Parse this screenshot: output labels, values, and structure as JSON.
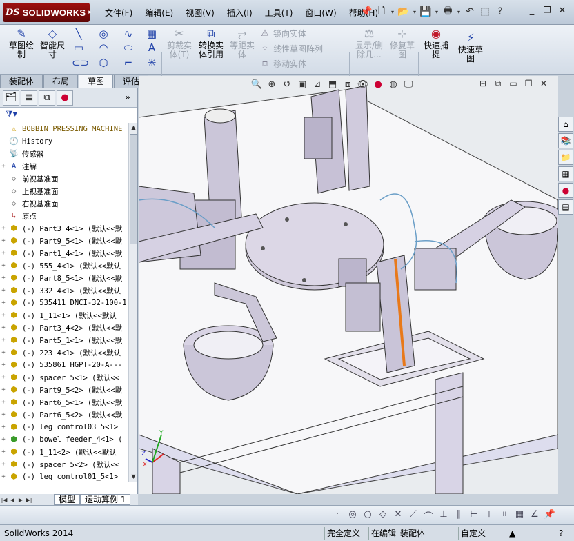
{
  "app": {
    "logo_ds": "DS",
    "logo_name": "SOLIDWORKS"
  },
  "menu": [
    "文件(F)",
    "编辑(E)",
    "视图(V)",
    "插入(I)",
    "工具(T)",
    "窗口(W)",
    "帮助(H)"
  ],
  "window_controls": [
    "_",
    "❐",
    "✕"
  ],
  "commands": {
    "sketch": "草图绘\n制",
    "smart_dim": "智能尺\n寸",
    "trim": "剪裁实\n体(T)",
    "convert": "转换实\n体引用",
    "offset": "等距实\n体",
    "mirror": "镜向实体",
    "linear_pattern": "线性草图阵列",
    "move": "移动实体",
    "show_delete": "显示/删\n除几...",
    "repair": "修复草\n图",
    "quick_snap": "快速捕\n捉",
    "rapid_sketch": "快速草\n图"
  },
  "tabs": [
    "装配体",
    "布局",
    "草图",
    "评估"
  ],
  "active_tab": "草图",
  "tree": {
    "root": "BOBBIN PRESSING MACHINE",
    "items": [
      {
        "label": "History",
        "icon": "history-icon",
        "exp": ""
      },
      {
        "label": "传感器",
        "icon": "sensor-icon",
        "exp": ""
      },
      {
        "label": "注解",
        "icon": "annotation-icon",
        "exp": "+"
      },
      {
        "label": "前视基准面",
        "icon": "plane-icon",
        "exp": ""
      },
      {
        "label": "上视基准面",
        "icon": "plane-icon",
        "exp": ""
      },
      {
        "label": "右视基准面",
        "icon": "plane-icon",
        "exp": ""
      },
      {
        "label": "原点",
        "icon": "origin-icon",
        "exp": ""
      },
      {
        "label": "(-) Part3_4<1> (默认<<默",
        "icon": "part-icon",
        "exp": "+"
      },
      {
        "label": "(-) Part9_5<1> (默认<<默",
        "icon": "part-icon",
        "exp": "+"
      },
      {
        "label": "(-) Part1_4<1> (默认<<默",
        "icon": "part-icon",
        "exp": "+"
      },
      {
        "label": "(-) 555_4<1> (默认<<默认",
        "icon": "part-icon",
        "exp": "+"
      },
      {
        "label": "(-) Part8_5<1> (默认<<默",
        "icon": "part-icon",
        "exp": "+"
      },
      {
        "label": "(-) 332_4<1> (默认<<默认",
        "icon": "part-icon",
        "exp": "+"
      },
      {
        "label": "(-) 535411 DNCI-32-100-1",
        "icon": "part-icon",
        "exp": "+"
      },
      {
        "label": "(-) 1_11<1> (默认<<默认",
        "icon": "part-icon",
        "exp": "+"
      },
      {
        "label": "(-) Part3_4<2> (默认<<默",
        "icon": "part-icon",
        "exp": "+"
      },
      {
        "label": "(-) Part5_1<1> (默认<<默",
        "icon": "part-icon",
        "exp": "+"
      },
      {
        "label": "(-) 223_4<1> (默认<<默认",
        "icon": "part-icon",
        "exp": "+"
      },
      {
        "label": "(-) 535861 HGPT-20-A---",
        "icon": "part-icon",
        "exp": "+"
      },
      {
        "label": "(-) spacer_5<1> (默认<<",
        "icon": "part-icon",
        "exp": "+"
      },
      {
        "label": "(-) Part9_5<2> (默认<<默",
        "icon": "part-icon",
        "exp": "+"
      },
      {
        "label": "(-) Part6_5<1> (默认<<默",
        "icon": "part-icon",
        "exp": "+"
      },
      {
        "label": "(-) Part6_5<2> (默认<<默",
        "icon": "part-icon",
        "exp": "+"
      },
      {
        "label": "(-) leg control03_5<1>",
        "icon": "part-icon",
        "exp": "+"
      },
      {
        "label": "(-) bowel feeder_4<1> (",
        "icon": "assembly-icon",
        "exp": "+"
      },
      {
        "label": "(-) 1_11<2> (默认<<默认",
        "icon": "part-icon",
        "exp": "+"
      },
      {
        "label": "(-) spacer_5<2> (默认<<",
        "icon": "part-icon",
        "exp": "+"
      },
      {
        "label": "(-) leg control01_5<1>",
        "icon": "part-icon",
        "exp": "+"
      }
    ]
  },
  "bottom_tabs": [
    "模型",
    "运动算例 1"
  ],
  "status": {
    "app_version": "SolidWorks 2014",
    "fully_defined": "完全定义",
    "editing": "在编辑",
    "editing_target": "装配体",
    "custom": "自定义"
  },
  "colors": {
    "brand": "#8a0c0c",
    "accent_orange": "#e8791a"
  }
}
